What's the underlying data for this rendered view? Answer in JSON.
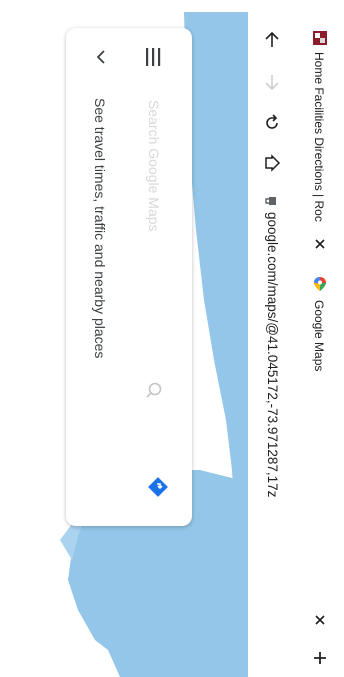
{
  "browser": {
    "tabs": [
      {
        "title": "Home Facilities Directions | Roc"
      },
      {
        "title": "Google Maps"
      }
    ],
    "url": "google.com/maps/@41.045172,-73.971287,17z"
  },
  "map": {
    "search_placeholder": "Search Google Maps",
    "hint": "See travel times, traffic and nearby places"
  },
  "colors": {
    "water": "#93c6e8",
    "water_light": "#a9d3ef",
    "card": "#ffffff",
    "accent_directions": "#1a73e8"
  },
  "icons": [
    "back-icon",
    "forward-icon",
    "reload-icon",
    "home-icon",
    "lock-icon",
    "menu-icon",
    "chevron-left-icon",
    "search-icon",
    "directions-icon",
    "close-icon",
    "new-tab-icon",
    "favicon-school",
    "favicon-maps"
  ]
}
